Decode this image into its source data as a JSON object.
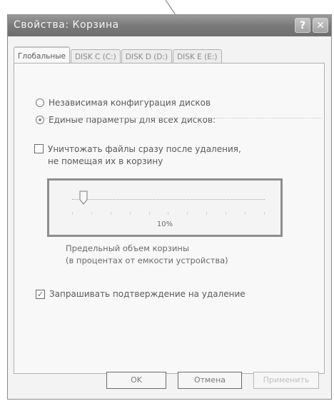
{
  "window": {
    "title": "Свойства: Корзина",
    "help_glyph": "?",
    "close_glyph": "✕"
  },
  "tabs": [
    {
      "label": "Глобальные",
      "active": true
    },
    {
      "label": "DISK C (C:)",
      "active": false
    },
    {
      "label": "DISK D (D:)",
      "active": false
    },
    {
      "label": "DISK E (E:)",
      "active": false
    }
  ],
  "options": {
    "independent": {
      "label": "Независимая конфигурация дисков",
      "selected": false
    },
    "unified": {
      "label": "Единые параметры для всех дисков:",
      "selected": true
    }
  },
  "delete_immediately": {
    "line1": "Уничтожать файлы сразу после удаления,",
    "line2": "не помещая их в корзину",
    "checked": false
  },
  "slider": {
    "value_label": "10%",
    "value_percent": 10
  },
  "description": {
    "line1": "Предельный объем корзины",
    "line2": "(в процентах от емкости устройства)"
  },
  "confirm_delete": {
    "label": "Запрашивать подтверждение на удаление",
    "checked": true
  },
  "buttons": {
    "ok": "OK",
    "cancel": "Отмена",
    "apply": "Применить"
  },
  "colors": {
    "titlebar": "#7a7a7a",
    "frame_highlight": "#8e8e8e"
  }
}
